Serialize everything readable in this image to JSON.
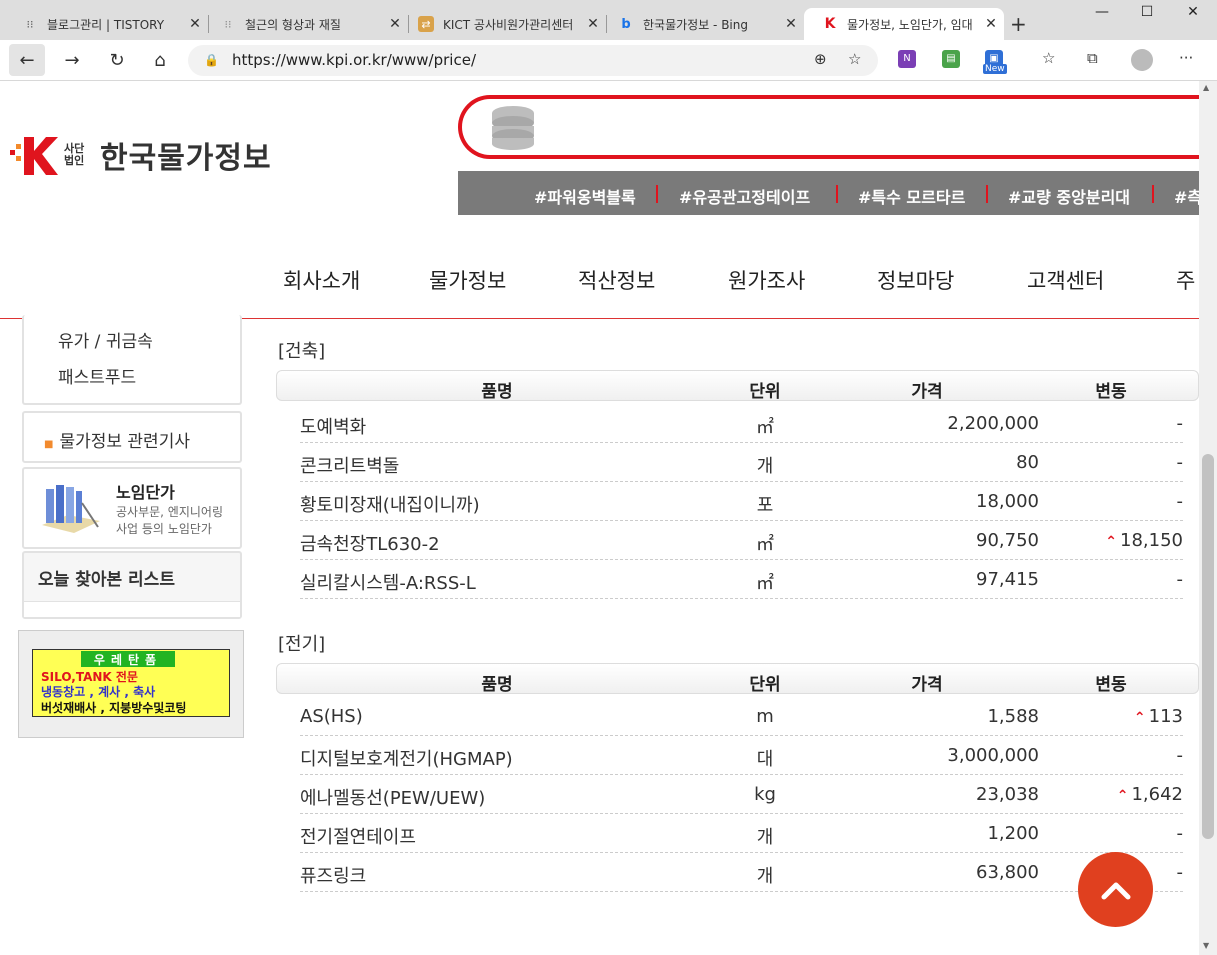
{
  "browser": {
    "tabs": [
      {
        "title": "블로그관리 | TISTORY",
        "icon": "tistory-icon",
        "close": "✕"
      },
      {
        "title": "철근의 형상과 재질",
        "icon": "tistory-icon",
        "close": "✕"
      },
      {
        "title": "KICT 공사비원가관리센터",
        "icon": "kict-icon",
        "close": "✕"
      },
      {
        "title": "한국물가정보 - Bing",
        "icon": "bing-icon",
        "close": "✕"
      },
      {
        "title": "물가정보, 노임단가, 임대",
        "icon": "kpi-icon",
        "close": "✕",
        "active": true
      }
    ],
    "new_tab": "+",
    "url": "https://www.kpi.or.kr/www/price/",
    "new_badge": "New"
  },
  "header": {
    "logo_legal": "사단법인",
    "logo_name": "한국물가정보",
    "hashtags": [
      "#파워옹벽블록",
      "#유공관고정테이프",
      "#특수 모르타르",
      "#교량 중앙분리대",
      "#측"
    ],
    "gnb": [
      "회사소개",
      "물가정보",
      "적산정보",
      "원가조사",
      "정보마당",
      "고객센터",
      "주"
    ]
  },
  "sidebar": {
    "links": [
      "유가 / 귀금속",
      "패스트푸드"
    ],
    "article_link": "물가정보 관련기사",
    "labor": {
      "title": "노임단가",
      "desc1": "공사부문, 엔지니어링",
      "desc2": "사업 등의 노임단가"
    },
    "recent": "오늘 찾아본 리스트",
    "ad": {
      "l1": "우레탄폼",
      "l2": "SILO,TANK 전문",
      "l3": "냉동창고 , 계사 , 축사",
      "l4": "버섯재배사 , 지붕방수및코팅"
    }
  },
  "tables": {
    "headers": {
      "name": "품명",
      "unit": "단위",
      "price": "가격",
      "change": "변동"
    },
    "sections": [
      {
        "title": "[건축]",
        "rows": [
          {
            "name": "도예벽화",
            "unit": "㎡",
            "price": "2,200,000",
            "change": "-",
            "up": false
          },
          {
            "name": "콘크리트벽돌",
            "unit": "개",
            "price": "80",
            "change": "-",
            "up": false
          },
          {
            "name": "황토미장재(내집이니까)",
            "unit": "포",
            "price": "18,000",
            "change": "-",
            "up": false
          },
          {
            "name": "금속천장TL630-2",
            "unit": "㎡",
            "price": "90,750",
            "change": "18,150",
            "up": true
          },
          {
            "name": "실리칼시스템-A:RSS-L",
            "unit": "㎡",
            "price": "97,415",
            "change": "-",
            "up": false
          }
        ]
      },
      {
        "title": "[전기]",
        "rows": [
          {
            "name": "AS(HS)",
            "unit": "m",
            "price": "1,588",
            "change": "113",
            "up": true
          },
          {
            "name": "디지털보호계전기(HGMAP)",
            "unit": "대",
            "price": "3,000,000",
            "change": "-",
            "up": false
          },
          {
            "name": "에나멜동선(PEW/UEW)",
            "unit": "kg",
            "price": "23,038",
            "change": "1,642",
            "up": true
          },
          {
            "name": "전기절연테이프",
            "unit": "개",
            "price": "1,200",
            "change": "-",
            "up": false
          },
          {
            "name": "퓨즈링크",
            "unit": "개",
            "price": "63,800",
            "change": "-",
            "up": false
          }
        ]
      }
    ]
  },
  "colors": {
    "brand_red": "#e0141e",
    "up_red": "#e0141e",
    "top_button": "#e0401f",
    "tag_bar": "#7a7a7a"
  }
}
